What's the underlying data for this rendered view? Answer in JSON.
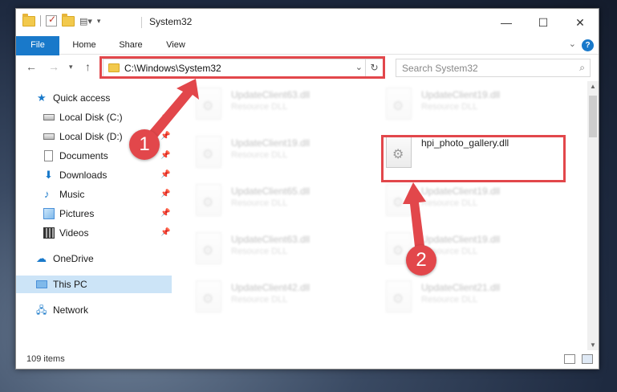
{
  "window": {
    "title": "System32",
    "controls": {
      "minimize": "—",
      "maximize": "☐",
      "close": "✕"
    }
  },
  "ribbon": {
    "tabs": [
      {
        "label": "File"
      },
      {
        "label": "Home"
      },
      {
        "label": "Share"
      },
      {
        "label": "View"
      }
    ],
    "help": "?"
  },
  "nav": {
    "address": "C:\\Windows\\System32",
    "search_placeholder": "Search System32"
  },
  "sidebar": {
    "items": [
      {
        "label": "Quick access",
        "icon": "star-icon",
        "pinned": false
      },
      {
        "label": "Local Disk (C:)",
        "icon": "drive-icon",
        "pinned": true
      },
      {
        "label": "Local Disk (D:)",
        "icon": "drive-icon",
        "pinned": true
      },
      {
        "label": "Documents",
        "icon": "document-icon",
        "pinned": true
      },
      {
        "label": "Downloads",
        "icon": "download-icon",
        "pinned": true
      },
      {
        "label": "Music",
        "icon": "music-icon",
        "pinned": true
      },
      {
        "label": "Pictures",
        "icon": "picture-icon",
        "pinned": true
      },
      {
        "label": "Videos",
        "icon": "video-icon",
        "pinned": true
      },
      {
        "label": "OneDrive",
        "icon": "cloud-icon",
        "pinned": false
      },
      {
        "label": "This PC",
        "icon": "computer-icon",
        "pinned": false,
        "selected": true
      },
      {
        "label": "Network",
        "icon": "network-icon",
        "pinned": false
      }
    ]
  },
  "files": [
    {
      "name": "UpdateClient63.dll",
      "type": "Resource DLL"
    },
    {
      "name": "UpdateClient19.dll",
      "type": "Resource DLL"
    },
    {
      "name": "UpdateClient19.dll",
      "type": "Resource DLL"
    },
    {
      "name": "hpi_photo_gallery.dll",
      "type": ""
    },
    {
      "name": "UpdateClient65.dll",
      "type": "Resource DLL"
    },
    {
      "name": "UpdateClient19.dll",
      "type": "Resource DLL"
    },
    {
      "name": "UpdateClient63.dll",
      "type": "Resource DLL"
    },
    {
      "name": "UpdateClient19.dll",
      "type": "Resource DLL"
    },
    {
      "name": "UpdateClient42.dll",
      "type": "Resource DLL"
    },
    {
      "name": "UpdateClient21.dll",
      "type": "Resource DLL"
    }
  ],
  "status": {
    "item_count": "109 items"
  },
  "annotations": [
    {
      "label": "1"
    },
    {
      "label": "2"
    }
  ],
  "colors": {
    "accent": "#1979ca",
    "highlight": "#e2474b",
    "selected": "#cce4f7"
  }
}
